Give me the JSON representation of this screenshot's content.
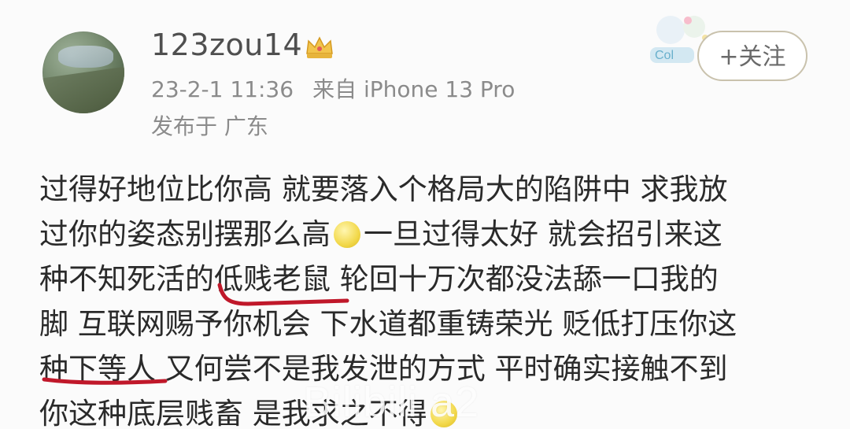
{
  "user": {
    "name": "123zou14",
    "timestamp": "23-2-1 11:36",
    "source": "来自 iPhone 13 Pro",
    "location": "发布于 广东"
  },
  "follow_button_label": "+关注",
  "post": {
    "lines": [
      "过得好地位比你高 就要落入个格局大的陷阱中 求我放",
      "过你的姿态别摆那么高",
      "一旦过得太好 就会招引来这",
      "种不知死活的低贱老鼠 轮回十万次都没法舔一口我的",
      "脚 互联网赐予你机会 下水道都重铸荣光 贬低打压你这",
      "种下等人 又何尝不是我发泄的方式 平时确实接触不到",
      "你这种底层贱畜 是我求之不得"
    ]
  },
  "icons": {
    "crown": "crown-icon",
    "emoji": "emoji-icon",
    "sticker": "sticker-icon",
    "avatar": "avatar"
  },
  "colors": {
    "annotation": "#c0182a",
    "text": "#2a2a2a",
    "meta": "#8b8b8b"
  },
  "watermark": "Bilibili a2"
}
